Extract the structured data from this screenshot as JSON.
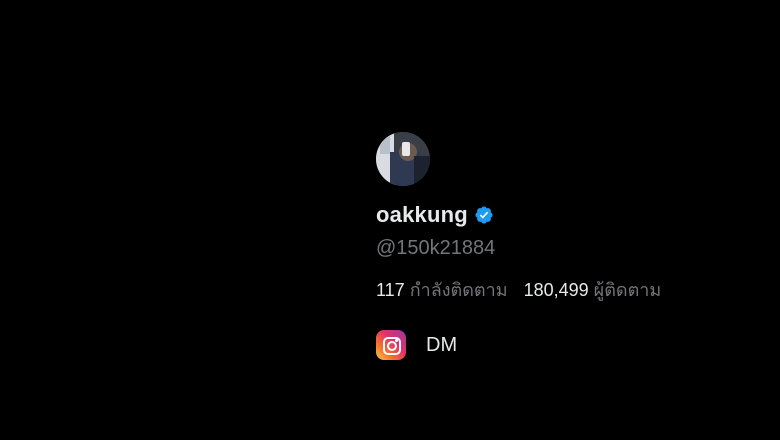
{
  "profile": {
    "display_name": "oakkung",
    "handle": "@150k21884",
    "verified": true,
    "avatar_icon": "profile-photo",
    "stats": {
      "following_count": "117",
      "following_label": "กำลังติดตาม",
      "followers_count": "180,499",
      "followers_label": "ผู้ติดตาม"
    },
    "link": {
      "icon": "instagram-icon",
      "label": "DM"
    }
  },
  "colors": {
    "background": "#000000",
    "primary_text": "#e7e9ea",
    "secondary_text": "#71767b",
    "verified_blue": "#1d9bf0"
  }
}
